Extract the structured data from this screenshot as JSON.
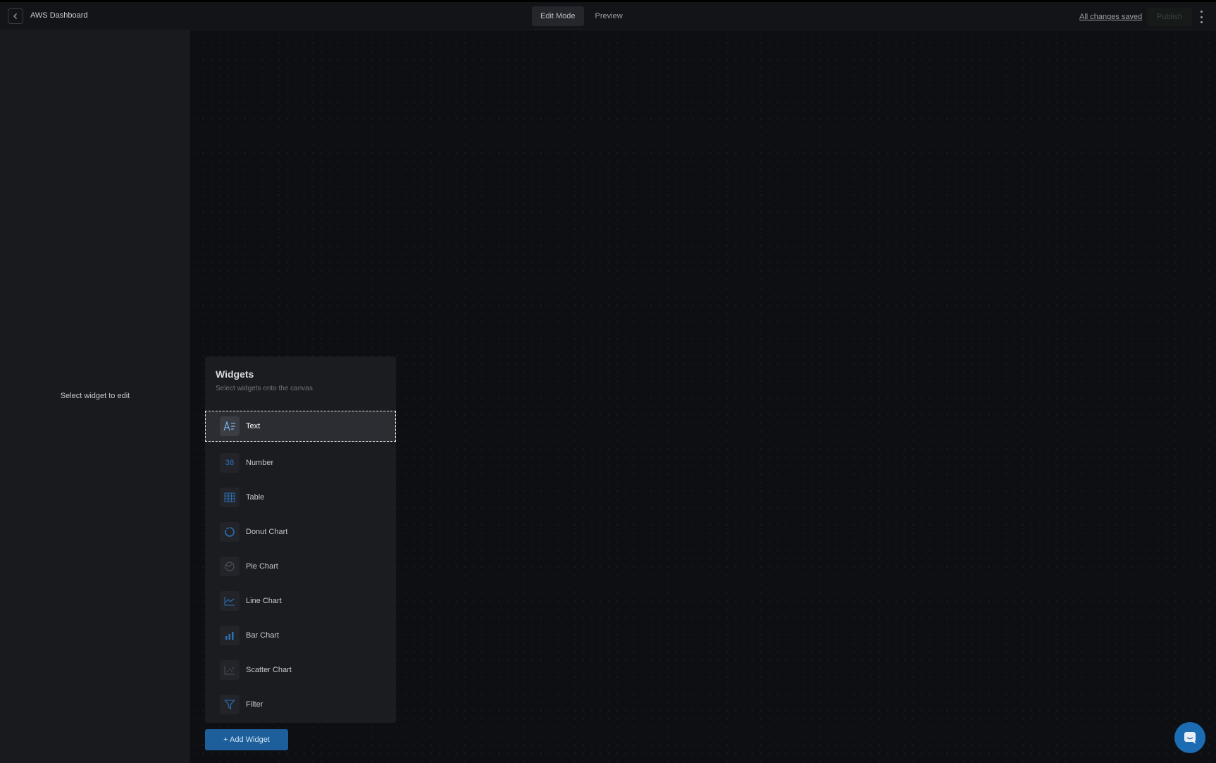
{
  "header": {
    "back_icon": "chevron-left-icon",
    "title": "AWS Dashboard",
    "tabs": [
      {
        "label": "Edit Mode",
        "active": true
      },
      {
        "label": "Preview",
        "active": false
      }
    ],
    "saved_status": "All changes saved",
    "publish_label": "Publish",
    "menu_icon": "kebab-menu-icon"
  },
  "editor_sidebar": {
    "hint": "Select widget to edit"
  },
  "widgets_panel": {
    "title": "Widgets",
    "subtitle": "Select widgets onto the canvas",
    "items": [
      {
        "label": "Text",
        "icon": "text-icon",
        "selected": true
      },
      {
        "label": "Number",
        "icon": "number-icon",
        "glyph": "38"
      },
      {
        "label": "Table",
        "icon": "table-icon"
      },
      {
        "label": "Donut Chart",
        "icon": "donut-chart-icon"
      },
      {
        "label": "Pie Chart",
        "icon": "pie-chart-icon"
      },
      {
        "label": "Line Chart",
        "icon": "line-chart-icon"
      },
      {
        "label": "Bar Chart",
        "icon": "bar-chart-icon"
      },
      {
        "label": "Scatter Chart",
        "icon": "scatter-chart-icon"
      },
      {
        "label": "Filter",
        "icon": "filter-icon"
      }
    ],
    "add_button_label": "+ Add Widget"
  },
  "chat": {
    "icon": "chat-icon"
  },
  "colors": {
    "accent": "#1d5f9b",
    "icon_blue": "#2e6fb4",
    "background": "#0e0f12"
  }
}
